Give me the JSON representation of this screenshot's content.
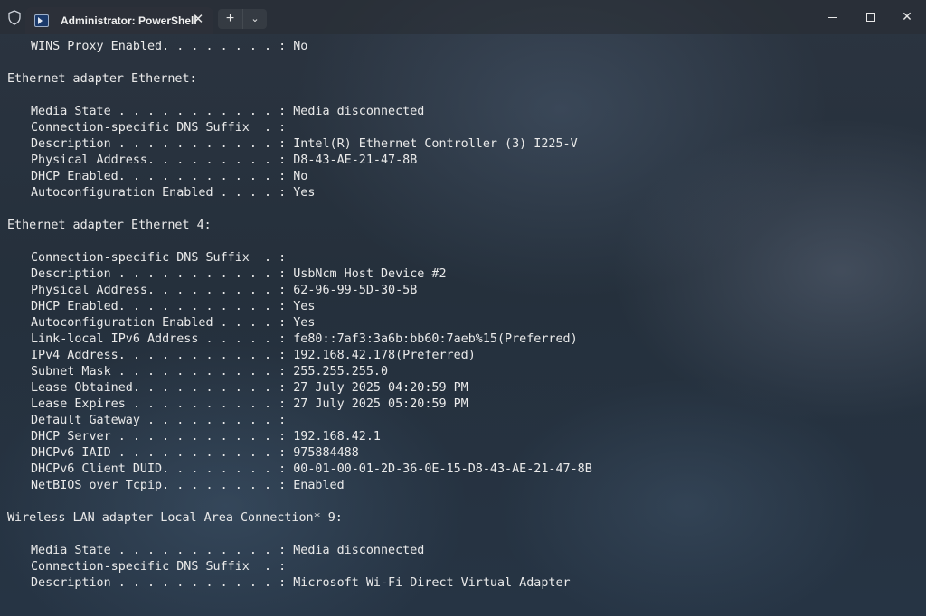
{
  "window": {
    "tab_title": "Administrator: PowerShell",
    "new_tab_label": "+",
    "dropdown_label": "⌄",
    "close_tab_label": "✕",
    "minimize_label": "",
    "maximize_label": "",
    "close_label": "✕",
    "icons": {
      "shield": "shield-icon",
      "powershell": "powershell-icon"
    }
  },
  "terminal": {
    "lines": [
      "WINS Proxy Enabled. . . . . . . . : No",
      "",
      "Ethernet adapter Ethernet:",
      "",
      "Media State . . . . . . . . . . . : Media disconnected",
      "Connection-specific DNS Suffix  . :",
      "Description . . . . . . . . . . . : Intel(R) Ethernet Controller (3) I225-V",
      "Physical Address. . . . . . . . . : D8-43-AE-21-47-8B",
      "DHCP Enabled. . . . . . . . . . . : No",
      "Autoconfiguration Enabled . . . . : Yes",
      "",
      "Ethernet adapter Ethernet 4:",
      "",
      "Connection-specific DNS Suffix  . :",
      "Description . . . . . . . . . . . : UsbNcm Host Device #2",
      "Physical Address. . . . . . . . . : 62-96-99-5D-30-5B",
      "DHCP Enabled. . . . . . . . . . . : Yes",
      "Autoconfiguration Enabled . . . . : Yes",
      "Link-local IPv6 Address . . . . . : fe80::7af3:3a6b:bb60:7aeb%15(Preferred)",
      "IPv4 Address. . . . . . . . . . . : 192.168.42.178(Preferred)",
      "Subnet Mask . . . . . . . . . . . : 255.255.255.0",
      "Lease Obtained. . . . . . . . . . : 27 July 2025 04:20:59 PM",
      "Lease Expires . . . . . . . . . . : 27 July 2025 05:20:59 PM",
      "Default Gateway . . . . . . . . . :",
      "DHCP Server . . . . . . . . . . . : 192.168.42.1",
      "DHCPv6 IAID . . . . . . . . . . . : 975884488",
      "DHCPv6 Client DUID. . . . . . . . : 00-01-00-01-2D-36-0E-15-D8-43-AE-21-47-8B",
      "NetBIOS over Tcpip. . . . . . . . : Enabled",
      "",
      "Wireless LAN adapter Local Area Connection* 9:",
      "",
      "Media State . . . . . . . . . . . : Media disconnected",
      "Connection-specific DNS Suffix  . :",
      "Description . . . . . . . . . . . : Microsoft Wi-Fi Direct Virtual Adapter"
    ]
  },
  "colors": {
    "text": "#eaeaea",
    "tab_background": "#2c3039",
    "terminal_background": "#25303c"
  }
}
